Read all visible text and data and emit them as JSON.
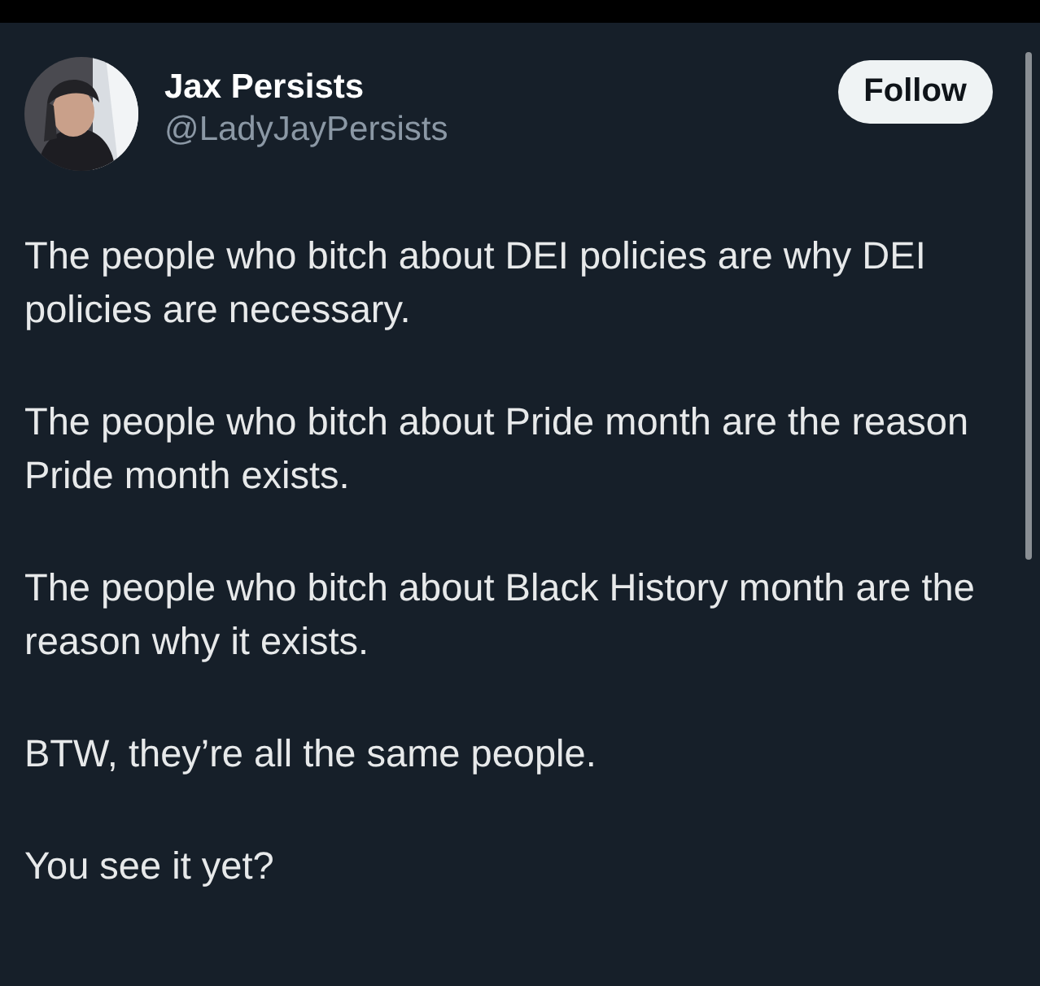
{
  "author": {
    "name": "Jax Persists",
    "handle": "@LadyJayPersists"
  },
  "follow_button": {
    "label": "Follow"
  },
  "paragraphs": [
    "The people who bitch about DEI policies are why DEI policies are necessary.",
    "The people who bitch about Pride month are the reason Pride month exists.",
    "The people who bitch about Black History month are the reason why it exists.",
    "BTW, they’re all the same people.",
    "You see it yet?"
  ]
}
